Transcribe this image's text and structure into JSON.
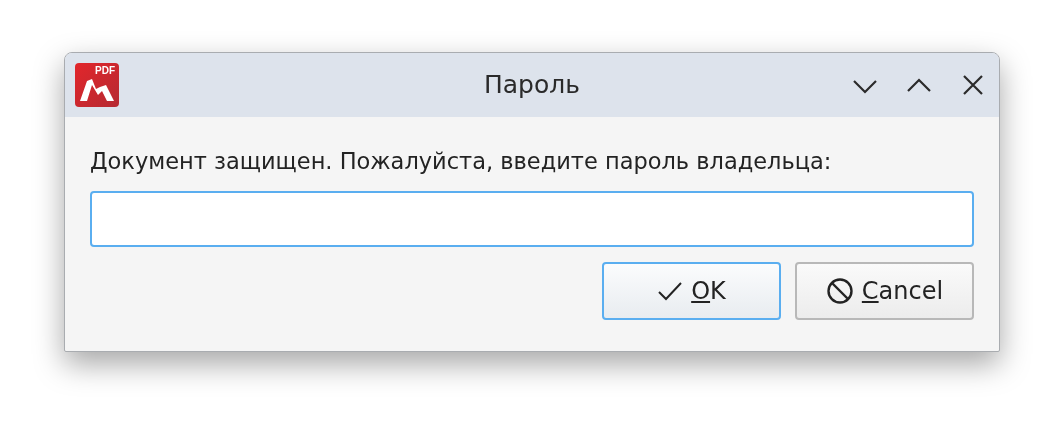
{
  "window": {
    "title": "Пароль",
    "logo_text": "PDF",
    "controls": [
      {
        "kind": "minimize"
      },
      {
        "kind": "maximize"
      },
      {
        "kind": "close"
      }
    ]
  },
  "prompt": "Документ защищен. Пожалуйста, введите пароль владельца:",
  "password_field": {
    "focused": true
  },
  "buttons": [
    {
      "kind": "ok",
      "mnemonic": "O",
      "rest": "K",
      "default": true
    },
    {
      "kind": "cancel",
      "mnemonic": "C",
      "rest": "ancel",
      "default": false
    }
  ]
}
